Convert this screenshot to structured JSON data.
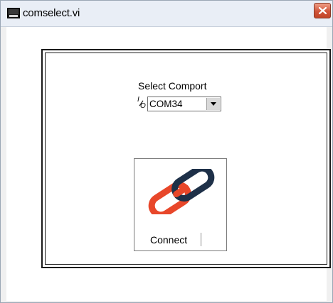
{
  "window": {
    "title": "comselect.vi",
    "icon": "labview-vi-icon",
    "close_icon": "close-x-icon"
  },
  "panel": {
    "comport_label": "Select Comport",
    "io_indicator": "I/O",
    "comport_value": "COM34",
    "dropdown_icon": "chevron-down-icon",
    "connect_label": "Connect",
    "connect_icon": "chain-link-icon",
    "colors": {
      "link_red": "#e8472a",
      "link_dark": "#1e3048",
      "close_red": "#d0553a"
    }
  }
}
